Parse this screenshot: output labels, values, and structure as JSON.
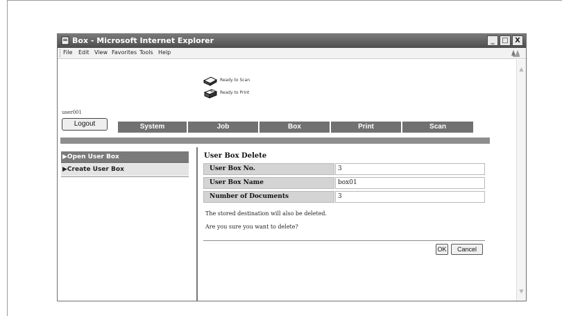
{
  "window": {
    "title": "Box - Microsoft Internet Explorer",
    "buttons": [
      "_",
      "□",
      "X"
    ]
  },
  "menu": [
    "File",
    "Edit",
    "View",
    "Favorites",
    "Tools",
    "Help"
  ],
  "scrollbar": {
    "up_icon": "▲",
    "down_icon": "▼"
  },
  "status": {
    "scan": "Ready to Scan",
    "print": "Ready to Print"
  },
  "user": {
    "name": "user001"
  },
  "buttons": {
    "logout": "Logout",
    "ok": "OK",
    "cancel": "Cancel"
  },
  "tabs": [
    "System",
    "Job",
    "Box",
    "Print",
    "Scan"
  ],
  "sidebar": {
    "items": [
      {
        "label": "▶Open User Box",
        "active": true
      },
      {
        "label": "▶Create User Box",
        "active": false
      }
    ]
  },
  "content": {
    "title": "User Box Delete",
    "rows": [
      {
        "label": "User Box No.",
        "value": "3"
      },
      {
        "label": "User Box Name",
        "value": "box01"
      },
      {
        "label": "Number of Documents",
        "value": "3"
      }
    ],
    "message_1": "The stored destination will also be deleted.",
    "message_2": "Are you sure you want to delete?"
  },
  "colors": {
    "titlebar_dark": "#4d4d4d",
    "tab_gray": "#717171",
    "active_nav": "#7a7a7a",
    "label_cell": "#d4d4d4"
  },
  "icons": {
    "window_icon": "ie-page-icon",
    "scanner": "scanner-icon",
    "printer": "printer-icon",
    "brand": "windows-xp-logo"
  }
}
